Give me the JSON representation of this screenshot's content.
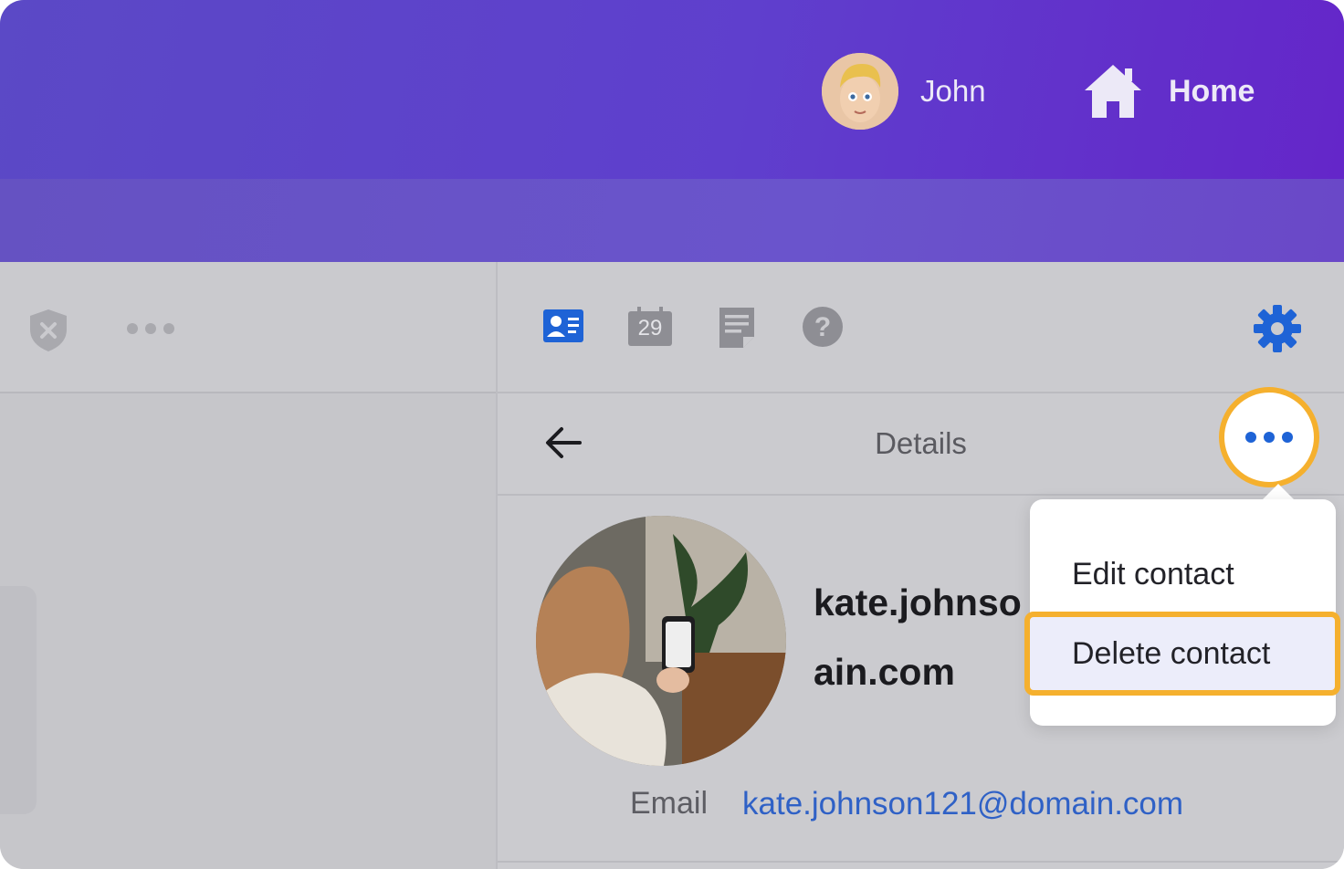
{
  "header": {
    "user_name": "John",
    "home_label": "Home"
  },
  "right_toolbar": {
    "calendar_day": "29"
  },
  "details": {
    "title": "Details"
  },
  "contact": {
    "name_partial": "kate.johnso",
    "email_partial": "ain.com",
    "email_label": "Email",
    "email_value": "kate.johnson121@domain.com"
  },
  "menu": {
    "edit_label": "Edit contact",
    "delete_label": "Delete contact"
  },
  "colors": {
    "accent": "#f5b02e",
    "link": "#2f61c6",
    "icon_blue": "#1e63d6"
  }
}
